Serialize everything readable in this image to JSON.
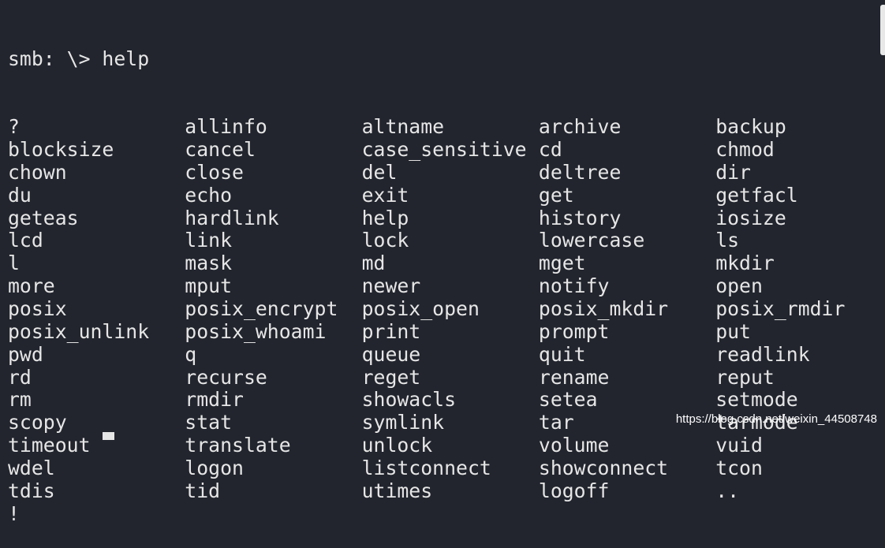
{
  "terminal": {
    "prompt_line": "smb: \\> help",
    "commands": [
      [
        "?",
        "allinfo",
        "altname",
        "archive",
        "backup"
      ],
      [
        "blocksize",
        "cancel",
        "case_sensitive",
        "cd",
        "chmod"
      ],
      [
        "chown",
        "close",
        "del",
        "deltree",
        "dir"
      ],
      [
        "du",
        "echo",
        "exit",
        "get",
        "getfacl"
      ],
      [
        "geteas",
        "hardlink",
        "help",
        "history",
        "iosize"
      ],
      [
        "lcd",
        "link",
        "lock",
        "lowercase",
        "ls"
      ],
      [
        "l",
        "mask",
        "md",
        "mget",
        "mkdir"
      ],
      [
        "more",
        "mput",
        "newer",
        "notify",
        "open"
      ],
      [
        "posix",
        "posix_encrypt",
        "posix_open",
        "posix_mkdir",
        "posix_rmdir"
      ],
      [
        "posix_unlink",
        "posix_whoami",
        "print",
        "prompt",
        "put"
      ],
      [
        "pwd",
        "q",
        "queue",
        "quit",
        "readlink"
      ],
      [
        "rd",
        "recurse",
        "reget",
        "rename",
        "reput"
      ],
      [
        "rm",
        "rmdir",
        "showacls",
        "setea",
        "setmode"
      ],
      [
        "scopy",
        "stat",
        "symlink",
        "tar",
        "tarmode"
      ],
      [
        "timeout",
        "translate",
        "unlock",
        "volume",
        "vuid"
      ],
      [
        "wdel",
        "logon",
        "listconnect",
        "showconnect",
        "tcon"
      ],
      [
        "tdis",
        "tid",
        "utimes",
        "logoff",
        ".."
      ],
      [
        "!"
      ]
    ]
  },
  "watermark": "https://blog.csdn.net/weixin_44508748",
  "colors": {
    "background": "#22252e",
    "text": "#e6e6e6"
  }
}
